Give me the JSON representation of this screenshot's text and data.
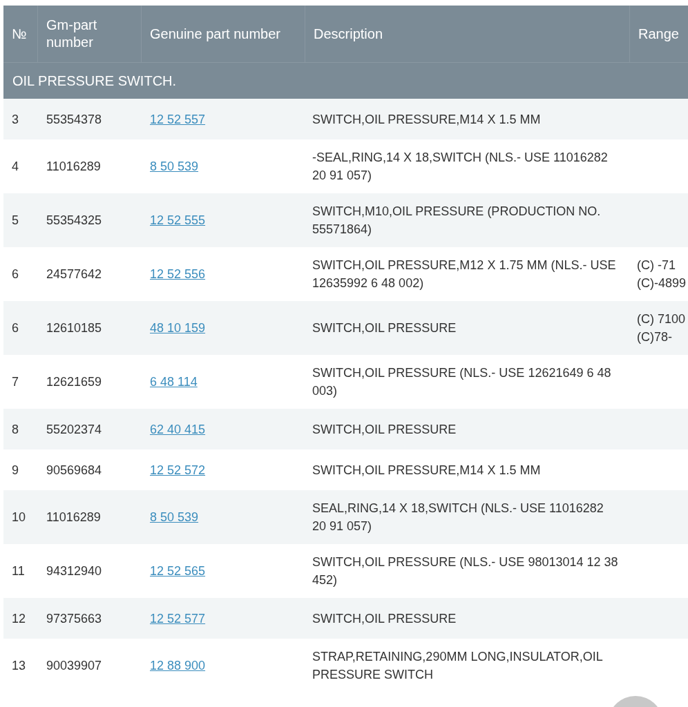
{
  "table": {
    "columns": [
      "№",
      "Gm-part number",
      "Genuine part number",
      "Description",
      "Range"
    ],
    "section": "OIL PRESSURE SWITCH.",
    "rows": [
      {
        "no": "3",
        "gm": "55354378",
        "genuine": "12 52 557",
        "description": "SWITCH,OIL PRESSURE,M14 X 1.5 MM",
        "range": []
      },
      {
        "no": "4",
        "gm": "11016289",
        "genuine": "8 50 539",
        "description": "-SEAL,RING,14 X 18,SWITCH (NLS.- USE 11016282 20 91 057)",
        "range": []
      },
      {
        "no": "5",
        "gm": "55354325",
        "genuine": "12 52 555",
        "description": "SWITCH,M10,OIL PRESSURE (PRODUCTION NO. 55571864)",
        "range": []
      },
      {
        "no": "6",
        "gm": "24577642",
        "genuine": "12 52 556",
        "description": "SWITCH,OIL PRESSURE,M12 X 1.75 MM (NLS.- USE 12635992 6 48 002)",
        "range": [
          "(C) -71",
          "(C)-4899"
        ]
      },
      {
        "no": "6",
        "gm": "12610185",
        "genuine": "48 10 159",
        "description": "SWITCH,OIL PRESSURE",
        "range": [
          "(C) 7100",
          "(C)78-"
        ]
      },
      {
        "no": "7",
        "gm": "12621659",
        "genuine": "6 48 114",
        "description": "SWITCH,OIL PRESSURE (NLS.- USE 12621649 6 48 003)",
        "range": []
      },
      {
        "no": "8",
        "gm": "55202374",
        "genuine": "62 40 415",
        "description": "SWITCH,OIL PRESSURE",
        "range": []
      },
      {
        "no": "9",
        "gm": "90569684",
        "genuine": "12 52 572",
        "description": "SWITCH,OIL PRESSURE,M14 X 1.5 MM",
        "range": []
      },
      {
        "no": "10",
        "gm": "11016289",
        "genuine": "8 50 539",
        "description": "SEAL,RING,14 X 18,SWITCH (NLS.- USE 11016282 20 91 057)",
        "range": []
      },
      {
        "no": "11",
        "gm": "94312940",
        "genuine": "12 52 565",
        "description": "SWITCH,OIL PRESSURE (NLS.- USE 98013014 12 38 452)",
        "range": []
      },
      {
        "no": "12",
        "gm": "97375663",
        "genuine": "12 52 577",
        "description": "SWITCH,OIL PRESSURE",
        "range": []
      },
      {
        "no": "13",
        "gm": "90039907",
        "genuine": "12 88 900",
        "description": "STRAP,RETAINING,290MM LONG,INSULATOR,OIL PRESSURE SWITCH",
        "range": []
      }
    ]
  }
}
